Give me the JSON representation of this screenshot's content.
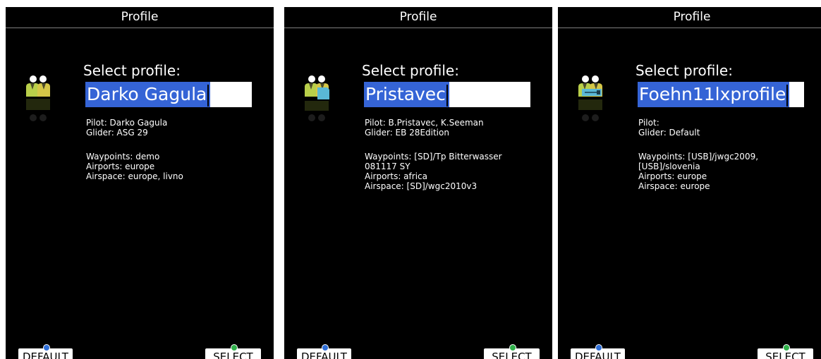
{
  "colors": {
    "screen_bg": "#000000",
    "selection": "#3564d6",
    "text": "#ffffff",
    "default_key_dot": "#2f6fd8",
    "select_key_dot": "#2fb04a"
  },
  "screens": [
    {
      "title": "Profile",
      "select_label": "Select profile:",
      "profile_name": "Darko Gagula",
      "pilot_line": "Pilot: Darko Gagula",
      "glider_line": "Glider: ASG 29",
      "files_text": "Waypoints: demo\nAirports: europe\nAirspace: europe, livno",
      "icon": "pilots-icon",
      "default_button": "DEFAULT",
      "select_button": "SELECT"
    },
    {
      "title": "Profile",
      "select_label": "Select profile:",
      "profile_name": "Pristavec",
      "pilot_line": "Pilot: B.Pristavec, K.Seeman",
      "glider_line": "Glider: EB 28Edition",
      "files_text": "Waypoints: [SD]/Tp Bitterwasser\n081117 SY\nAirports: africa\nAirspace: [SD]/wgc2010v3",
      "icon": "pilots-sd-card-icon",
      "default_button": "DEFAULT",
      "select_button": "SELECT"
    },
    {
      "title": "Profile",
      "select_label": "Select profile:",
      "profile_name": "Foehn11lxprofile",
      "pilot_line": "Pilot:",
      "glider_line": "Glider: Default",
      "files_text": "Waypoints: [USB]/jwgc2009,\n[USB]/slovenia\nAirports: europe\nAirspace: europe",
      "icon": "pilots-usb-icon",
      "default_button": "DEFAULT",
      "select_button": "SELECT"
    }
  ]
}
